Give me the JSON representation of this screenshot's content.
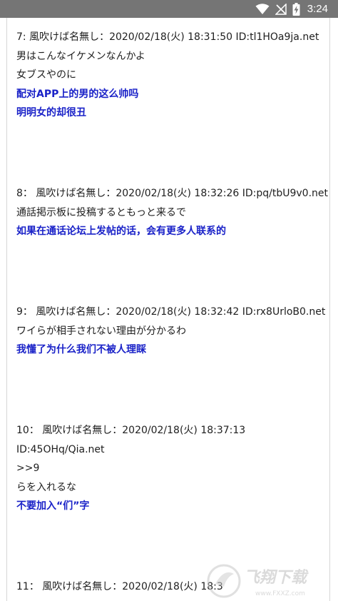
{
  "status_bar": {
    "time": "3:24",
    "icons": [
      "wifi-icon",
      "signal-off-icon",
      "battery-charging-icon"
    ]
  },
  "posts": [
    {
      "lines": [
        {
          "text": "7:  風吹けば名無し：2020/02/18(火) 18:31:50 ID:tl1HOa9ja.net",
          "kind": "header"
        },
        {
          "text": "男はこんなイケメンなんかよ",
          "kind": "body"
        },
        {
          "text": "女ブスやのに",
          "kind": "body"
        },
        {
          "text": "配对APP上的男的这么帅吗",
          "kind": "trans"
        },
        {
          "text": "明明女的却很丑",
          "kind": "trans"
        }
      ]
    },
    {
      "lines": [
        {
          "text": "8：  風吹けば名無し：2020/02/18(火) 18:32:26 ID:pq/tbU9v0.net",
          "kind": "header"
        },
        {
          "text": "通話掲示板に投稿するともっと来るで",
          "kind": "body"
        },
        {
          "text": "如果在通话论坛上发帖的话，会有更多人联系的",
          "kind": "trans"
        }
      ]
    },
    {
      "lines": [
        {
          "text": "9：  風吹けば名無し：2020/02/18(火) 18:32:42 ID:rx8UrloB0.net",
          "kind": "header"
        },
        {
          "text": "ワイらが相手されない理由が分かるわ",
          "kind": "body"
        },
        {
          "text": "我懂了为什么我们不被人理睬",
          "kind": "trans"
        }
      ]
    },
    {
      "lines": [
        {
          "text": "10：  風吹けば名無し：2020/02/18(火) 18:37:13",
          "kind": "header"
        },
        {
          "text": "ID:45OHq/Qia.net",
          "kind": "header"
        },
        {
          "text": ">>9",
          "kind": "body"
        },
        {
          "text": "らを入れるな",
          "kind": "body"
        },
        {
          "text": "不要加入“们”字",
          "kind": "trans"
        }
      ]
    },
    {
      "lines": [
        {
          "text": "11：  風吹けば名無し：2020/02/18(火) 18:3",
          "kind": "header"
        }
      ]
    }
  ],
  "watermark": {
    "text": "飞翔下载",
    "url": "www.FXXZ.com",
    "icon": "watermark-logo-icon"
  }
}
